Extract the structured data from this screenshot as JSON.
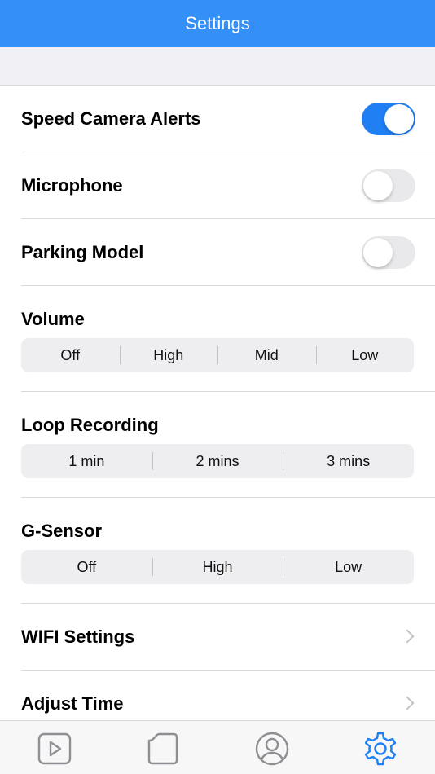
{
  "header": {
    "title": "Settings"
  },
  "settings": {
    "toggles": [
      {
        "label": "Speed Camera Alerts",
        "on": true
      },
      {
        "label": "Microphone",
        "on": false
      },
      {
        "label": "Parking Model",
        "on": false
      }
    ],
    "volume": {
      "label": "Volume",
      "options": [
        "Off",
        "High",
        "Mid",
        "Low"
      ]
    },
    "loop_recording": {
      "label": "Loop Recording",
      "options": [
        "1 min",
        "2 mins",
        "3 mins"
      ]
    },
    "g_sensor": {
      "label": "G-Sensor",
      "options": [
        "Off",
        "High",
        "Low"
      ]
    },
    "nav_rows": [
      {
        "label": "WIFI Settings"
      },
      {
        "label": "Adjust Time"
      }
    ]
  },
  "tab_bar": {
    "tabs": [
      {
        "icon": "video-play-icon",
        "active": false
      },
      {
        "icon": "folder-icon",
        "active": false
      },
      {
        "icon": "profile-icon",
        "active": false
      },
      {
        "icon": "gear-icon",
        "active": true
      }
    ],
    "active_color": "#1f7ff3",
    "inactive_color": "#8e8e93"
  },
  "colors": {
    "nav_bar": "#3490f6",
    "switch_on": "#1f7ff3",
    "switch_off": "#e9e9eb"
  }
}
